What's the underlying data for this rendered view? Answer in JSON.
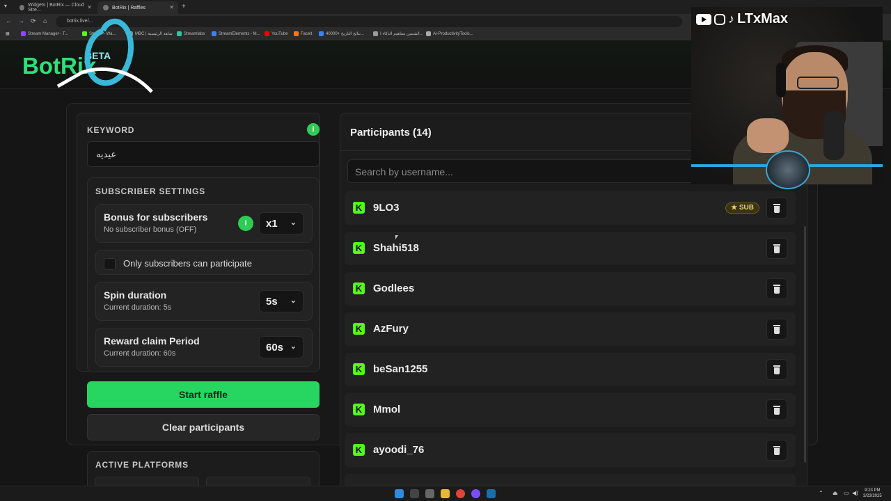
{
  "browser": {
    "tabs": [
      {
        "title": "Widgets | BotRix — Cloud Stre..."
      },
      {
        "title": "BotRix | Raffles"
      }
    ],
    "url": "botrix.live/...",
    "bookmarks": [
      {
        "label": "Stream Manager - T..."
      },
      {
        "label": "Stream - Wa..."
      },
      {
        "label": "MBC | شاهد الرئيسية"
      },
      {
        "label": "Streamlabs"
      },
      {
        "label": "StreamElements - M..."
      },
      {
        "label": "YouTube"
      },
      {
        "label": "Faceit"
      },
      {
        "label": "40000+ نتائج التاريخ..."
      },
      {
        "label": "الشنبين مفاهيم الذكاء ا..."
      },
      {
        "label": "AI-ProductivityTools..."
      }
    ]
  },
  "site": {
    "logo": "BotRix",
    "beta": "BETA"
  },
  "raffle": {
    "keyword_label": "KEYWORD",
    "keyword_value": "عيديه",
    "subscriber_settings_label": "SUBSCRIBER SETTINGS",
    "bonus": {
      "title": "Bonus for subscribers",
      "subtitle": "No subscriber bonus (OFF)",
      "value": "x1"
    },
    "only_subs_label": "Only subscribers can participate",
    "spin": {
      "title": "Spin duration",
      "subtitle": "Current duration: 5s",
      "value": "5s"
    },
    "reward": {
      "title": "Reward claim Period",
      "subtitle": "Current duration: 60s",
      "value": "60s"
    },
    "start_label": "Start raffle",
    "clear_label": "Clear participants",
    "platforms_label": "ACTIVE PLATFORMS",
    "info_glyph": "i"
  },
  "participants": {
    "title": "Participants (14)",
    "search_placeholder": "Search by username...",
    "sub_badge": "SUB",
    "platform_glyph": "K",
    "list": [
      {
        "name": "9LO3",
        "sub": true
      },
      {
        "name": "Shahi518",
        "sub": false
      },
      {
        "name": "Godlees",
        "sub": false
      },
      {
        "name": "AzFury",
        "sub": false
      },
      {
        "name": "beSan1255",
        "sub": false
      },
      {
        "name": "Mmol",
        "sub": false
      },
      {
        "name": "ayoodi_76",
        "sub": false
      }
    ]
  },
  "streamer": {
    "handle": "LTxMax"
  },
  "taskbar": {
    "time": "9:23 PM",
    "date": "3/23/2025"
  },
  "colors": {
    "accent_green": "#27d660",
    "kick_green": "#53fc18"
  }
}
